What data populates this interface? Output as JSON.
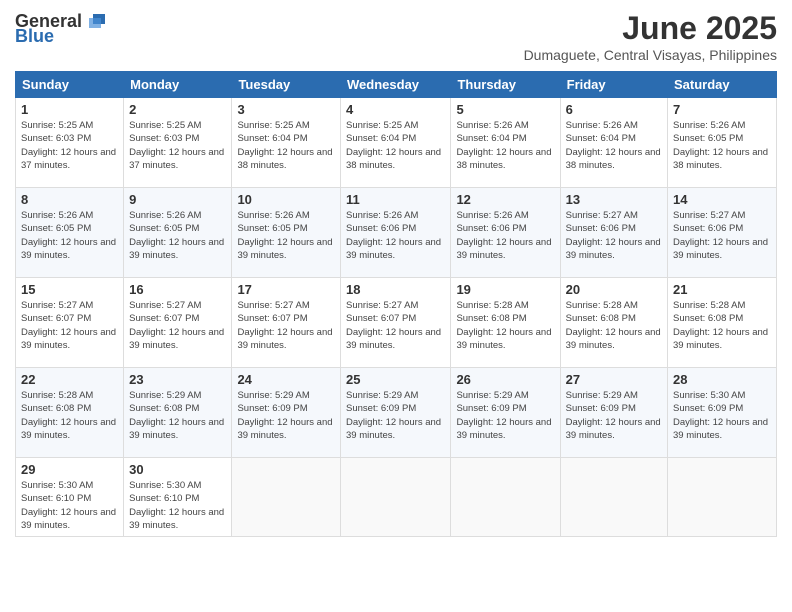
{
  "header": {
    "logo_general": "General",
    "logo_blue": "Blue",
    "title": "June 2025",
    "subtitle": "Dumaguete, Central Visayas, Philippines"
  },
  "calendar": {
    "headers": [
      "Sunday",
      "Monday",
      "Tuesday",
      "Wednesday",
      "Thursday",
      "Friday",
      "Saturday"
    ],
    "weeks": [
      [
        null,
        {
          "day": 2,
          "sunrise": "5:25 AM",
          "sunset": "6:03 PM",
          "daylight": "12 hours and 37 minutes."
        },
        {
          "day": 3,
          "sunrise": "5:25 AM",
          "sunset": "6:04 PM",
          "daylight": "12 hours and 38 minutes."
        },
        {
          "day": 4,
          "sunrise": "5:25 AM",
          "sunset": "6:04 PM",
          "daylight": "12 hours and 38 minutes."
        },
        {
          "day": 5,
          "sunrise": "5:26 AM",
          "sunset": "6:04 PM",
          "daylight": "12 hours and 38 minutes."
        },
        {
          "day": 6,
          "sunrise": "5:26 AM",
          "sunset": "6:04 PM",
          "daylight": "12 hours and 38 minutes."
        },
        {
          "day": 7,
          "sunrise": "5:26 AM",
          "sunset": "6:05 PM",
          "daylight": "12 hours and 38 minutes."
        }
      ],
      [
        {
          "day": 8,
          "sunrise": "5:26 AM",
          "sunset": "6:05 PM",
          "daylight": "12 hours and 39 minutes."
        },
        {
          "day": 9,
          "sunrise": "5:26 AM",
          "sunset": "6:05 PM",
          "daylight": "12 hours and 39 minutes."
        },
        {
          "day": 10,
          "sunrise": "5:26 AM",
          "sunset": "6:05 PM",
          "daylight": "12 hours and 39 minutes."
        },
        {
          "day": 11,
          "sunrise": "5:26 AM",
          "sunset": "6:06 PM",
          "daylight": "12 hours and 39 minutes."
        },
        {
          "day": 12,
          "sunrise": "5:26 AM",
          "sunset": "6:06 PM",
          "daylight": "12 hours and 39 minutes."
        },
        {
          "day": 13,
          "sunrise": "5:27 AM",
          "sunset": "6:06 PM",
          "daylight": "12 hours and 39 minutes."
        },
        {
          "day": 14,
          "sunrise": "5:27 AM",
          "sunset": "6:06 PM",
          "daylight": "12 hours and 39 minutes."
        }
      ],
      [
        {
          "day": 15,
          "sunrise": "5:27 AM",
          "sunset": "6:07 PM",
          "daylight": "12 hours and 39 minutes."
        },
        {
          "day": 16,
          "sunrise": "5:27 AM",
          "sunset": "6:07 PM",
          "daylight": "12 hours and 39 minutes."
        },
        {
          "day": 17,
          "sunrise": "5:27 AM",
          "sunset": "6:07 PM",
          "daylight": "12 hours and 39 minutes."
        },
        {
          "day": 18,
          "sunrise": "5:27 AM",
          "sunset": "6:07 PM",
          "daylight": "12 hours and 39 minutes."
        },
        {
          "day": 19,
          "sunrise": "5:28 AM",
          "sunset": "6:08 PM",
          "daylight": "12 hours and 39 minutes."
        },
        {
          "day": 20,
          "sunrise": "5:28 AM",
          "sunset": "6:08 PM",
          "daylight": "12 hours and 39 minutes."
        },
        {
          "day": 21,
          "sunrise": "5:28 AM",
          "sunset": "6:08 PM",
          "daylight": "12 hours and 39 minutes."
        }
      ],
      [
        {
          "day": 22,
          "sunrise": "5:28 AM",
          "sunset": "6:08 PM",
          "daylight": "12 hours and 39 minutes."
        },
        {
          "day": 23,
          "sunrise": "5:29 AM",
          "sunset": "6:08 PM",
          "daylight": "12 hours and 39 minutes."
        },
        {
          "day": 24,
          "sunrise": "5:29 AM",
          "sunset": "6:09 PM",
          "daylight": "12 hours and 39 minutes."
        },
        {
          "day": 25,
          "sunrise": "5:29 AM",
          "sunset": "6:09 PM",
          "daylight": "12 hours and 39 minutes."
        },
        {
          "day": 26,
          "sunrise": "5:29 AM",
          "sunset": "6:09 PM",
          "daylight": "12 hours and 39 minutes."
        },
        {
          "day": 27,
          "sunrise": "5:29 AM",
          "sunset": "6:09 PM",
          "daylight": "12 hours and 39 minutes."
        },
        {
          "day": 28,
          "sunrise": "5:30 AM",
          "sunset": "6:09 PM",
          "daylight": "12 hours and 39 minutes."
        }
      ],
      [
        {
          "day": 29,
          "sunrise": "5:30 AM",
          "sunset": "6:10 PM",
          "daylight": "12 hours and 39 minutes."
        },
        {
          "day": 30,
          "sunrise": "5:30 AM",
          "sunset": "6:10 PM",
          "daylight": "12 hours and 39 minutes."
        },
        null,
        null,
        null,
        null,
        null
      ]
    ],
    "week0_day1": {
      "day": 1,
      "sunrise": "5:25 AM",
      "sunset": "6:03 PM",
      "daylight": "12 hours and 37 minutes."
    }
  }
}
